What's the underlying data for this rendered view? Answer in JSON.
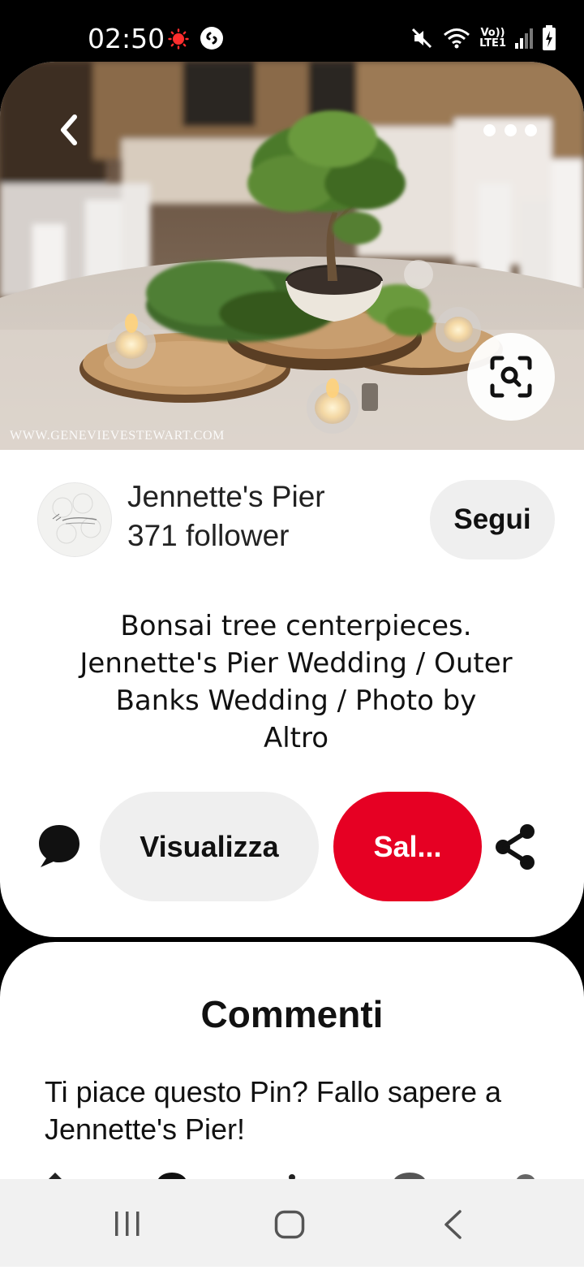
{
  "status_bar": {
    "time": "02:50",
    "network_label_top": "Vo))",
    "network_label_bottom": "LTE1"
  },
  "pin": {
    "watermark": "WWW.GENEVIEVESTEWART.COM",
    "description_lines": [
      "Bonsai tree centerpieces.",
      "Jennette's Pier Wedding / Outer",
      "Banks Wedding / Photo by",
      "Altro"
    ]
  },
  "profile": {
    "name": "Jennette's Pier",
    "followers": "371 follower",
    "follow_label": "Segui"
  },
  "actions": {
    "view_label": "Visualizza",
    "save_label": "Sal..."
  },
  "comments": {
    "title": "Commenti",
    "prompt": "Ti piace questo Pin? Fallo sapere a Jennette's Pier!"
  },
  "colors": {
    "brand_red": "#e60023",
    "button_gray": "#efefef",
    "text": "#111111"
  },
  "icons": {
    "back": "chevron-left-icon",
    "more": "more-dots-icon",
    "lens": "visual-search-icon",
    "comment": "comment-bubble-icon",
    "share": "share-icon",
    "nav_recents": "recents-icon",
    "nav_home": "home-icon",
    "nav_back": "nav-back-icon"
  }
}
